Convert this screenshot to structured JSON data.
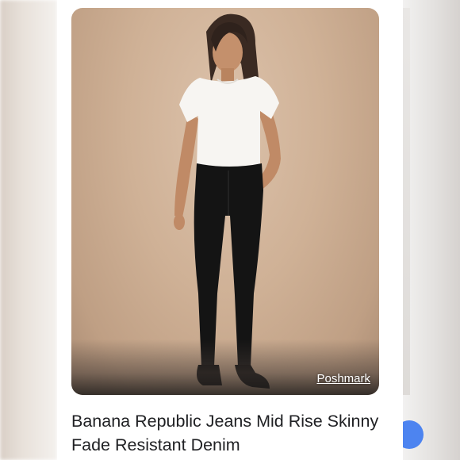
{
  "result": {
    "source": "Poshmark",
    "title": "Banana Republic Jeans Mid Rise Skinny Fade Resistant Denim"
  },
  "colors": {
    "background_wall": "#cfb196",
    "shirt": "#f7f5f2",
    "jeans": "#141414",
    "fab": "#4d84f0"
  }
}
